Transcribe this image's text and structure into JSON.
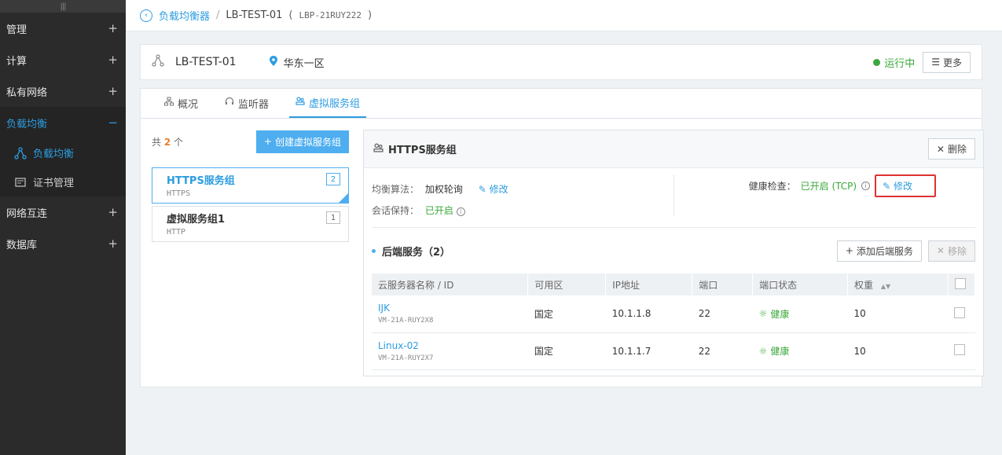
{
  "sidebar": {
    "handle": "|||",
    "items": [
      {
        "label": "管理",
        "toggle": "+"
      },
      {
        "label": "计算",
        "toggle": "+"
      },
      {
        "label": "私有网络",
        "toggle": "+"
      },
      {
        "label": "负载均衡",
        "toggle": "−"
      },
      {
        "label": "网络互连",
        "toggle": "+"
      },
      {
        "label": "数据库",
        "toggle": "+"
      }
    ],
    "subitems": [
      {
        "label": "负载均衡"
      },
      {
        "label": "证书管理"
      }
    ]
  },
  "breadcrumb": {
    "back": "‹",
    "root": "负载均衡器",
    "sep": "/",
    "current": "LB-TEST-01",
    "paren_open": "(",
    "id": "LBP-21RUY222",
    "paren_close": ")"
  },
  "header": {
    "name": "LB-TEST-01",
    "region": "华东一区",
    "status": "运行中",
    "more_label": "更多"
  },
  "tabs": [
    {
      "label": "概况"
    },
    {
      "label": "监听器"
    },
    {
      "label": "虚拟服务组"
    }
  ],
  "left": {
    "count_prefix": "共",
    "count_value": "2",
    "count_suffix": "个",
    "create_label": "创建虚拟服务组",
    "groups": [
      {
        "name": "HTTPS服务组",
        "protocol": "HTTPS",
        "count": "2"
      },
      {
        "name": "虚拟服务组1",
        "protocol": "HTTP",
        "count": "1"
      }
    ]
  },
  "detail": {
    "title": "HTTPS服务组",
    "delete_label": "删除",
    "algo_label": "均衡算法：",
    "algo_value": "加权轮询",
    "edit_label": "修改",
    "session_label": "会话保持：",
    "session_value": "已开启",
    "health_label": "健康检查：",
    "health_value": "已开启 (TCP)",
    "health_edit_label": "修改",
    "backend_title": "后端服务（2）",
    "add_backend_label": "添加后端服务",
    "remove_label": "移除",
    "table": {
      "headers": [
        "云服务器名称 / ID",
        "可用区",
        "IP地址",
        "端口",
        "端口状态",
        "权重"
      ],
      "rows": [
        {
          "name": "IJK",
          "id": "VM-21A-RUY2X8",
          "zone": "国定",
          "ip": "10.1.1.8",
          "port": "22",
          "status": "健康",
          "weight": "10"
        },
        {
          "name": "Linux-02",
          "id": "VM-21A-RUY2X7",
          "zone": "国定",
          "ip": "10.1.1.7",
          "port": "22",
          "status": "健康",
          "weight": "10"
        }
      ]
    }
  },
  "colors": {
    "accent": "#2d9de0",
    "success": "#3aa83a",
    "highlight": "#e03131",
    "count": "#e8802b"
  }
}
